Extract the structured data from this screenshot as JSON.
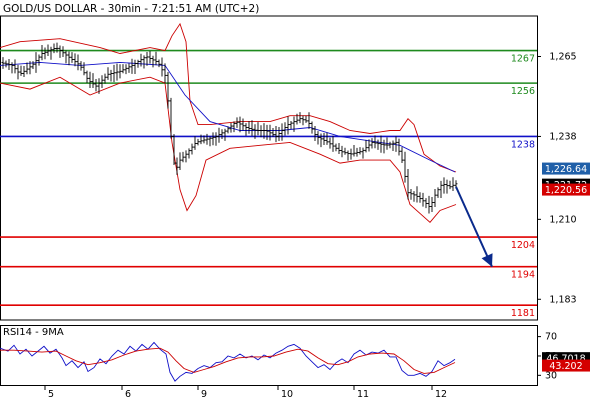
{
  "chart_data": [
    {
      "type": "candlestick",
      "title": "GOLD/US DOLLAR - 30min - 7:21:51 AM (UTC+2)",
      "ylim": [
        1176,
        1278
      ],
      "x_ticks": [
        "5",
        "6",
        "9",
        "10",
        "11",
        "12"
      ],
      "y_ticks": [
        {
          "value": 1265,
          "label": "1,265"
        },
        {
          "value": 1238,
          "label": "1,238"
        },
        {
          "value": 1210,
          "label": "1,210"
        },
        {
          "value": 1183,
          "label": "1,183"
        }
      ],
      "levels": [
        {
          "value": 1267,
          "label": "1267",
          "color": "#1e8a1e"
        },
        {
          "value": 1256,
          "label": "1256",
          "color": "#1e8a1e"
        },
        {
          "value": 1238,
          "label": "1238",
          "color": "#1010c8"
        },
        {
          "value": 1204,
          "label": "1204",
          "color": "#e00000"
        },
        {
          "value": 1194,
          "label": "1194",
          "color": "#e00000"
        },
        {
          "value": 1181,
          "label": "1181",
          "color": "#e00000"
        }
      ],
      "price_badges": [
        {
          "value": 1226.64,
          "label": "1,226.64",
          "color": "#1f5fa8"
        },
        {
          "value": 1221.72,
          "label": "1,221.72",
          "color": "#000000"
        },
        {
          "value": 1220.56,
          "label": "1,220.56",
          "color": "#d40000"
        }
      ],
      "close_path": [
        [
          0,
          1263
        ],
        [
          12,
          1262
        ],
        [
          20,
          1259
        ],
        [
          32,
          1262
        ],
        [
          42,
          1266
        ],
        [
          56,
          1268
        ],
        [
          68,
          1265
        ],
        [
          80,
          1262
        ],
        [
          88,
          1257
        ],
        [
          96,
          1255
        ],
        [
          108,
          1259
        ],
        [
          120,
          1260
        ],
        [
          132,
          1262
        ],
        [
          146,
          1265
        ],
        [
          158,
          1263
        ],
        [
          166,
          1258
        ],
        [
          171,
          1238
        ],
        [
          175,
          1226
        ],
        [
          180,
          1230
        ],
        [
          186,
          1232
        ],
        [
          196,
          1236
        ],
        [
          206,
          1237
        ],
        [
          216,
          1238
        ],
        [
          226,
          1240
        ],
        [
          236,
          1243
        ],
        [
          246,
          1241
        ],
        [
          256,
          1240
        ],
        [
          266,
          1240
        ],
        [
          276,
          1238
        ],
        [
          288,
          1242
        ],
        [
          300,
          1244
        ],
        [
          308,
          1243
        ],
        [
          316,
          1238
        ],
        [
          328,
          1236
        ],
        [
          340,
          1233
        ],
        [
          350,
          1232
        ],
        [
          362,
          1233
        ],
        [
          372,
          1236
        ],
        [
          386,
          1235
        ],
        [
          396,
          1236
        ],
        [
          402,
          1230
        ],
        [
          408,
          1219
        ],
        [
          416,
          1218
        ],
        [
          424,
          1216
        ],
        [
          430,
          1214
        ],
        [
          436,
          1219
        ],
        [
          442,
          1222
        ],
        [
          450,
          1221
        ],
        [
          456,
          1222
        ]
      ],
      "forecast_arrow": [
        [
          456,
          1221
        ],
        [
          492,
          1194
        ]
      ],
      "moving_average": [
        [
          0,
          1262
        ],
        [
          40,
          1263
        ],
        [
          80,
          1262
        ],
        [
          120,
          1263
        ],
        [
          165,
          1262
        ],
        [
          185,
          1252
        ],
        [
          210,
          1243
        ],
        [
          240,
          1240
        ],
        [
          280,
          1240
        ],
        [
          310,
          1241
        ],
        [
          340,
          1238
        ],
        [
          380,
          1236
        ],
        [
          400,
          1235
        ],
        [
          430,
          1230
        ],
        [
          455,
          1226
        ]
      ],
      "bollinger_upper": [
        [
          0,
          1268
        ],
        [
          20,
          1270
        ],
        [
          60,
          1271
        ],
        [
          100,
          1268
        ],
        [
          120,
          1266
        ],
        [
          150,
          1268
        ],
        [
          165,
          1267
        ],
        [
          172,
          1272
        ],
        [
          180,
          1276
        ],
        [
          186,
          1270
        ],
        [
          190,
          1250
        ],
        [
          198,
          1242
        ],
        [
          210,
          1242
        ],
        [
          240,
          1243
        ],
        [
          270,
          1243
        ],
        [
          290,
          1245
        ],
        [
          310,
          1245
        ],
        [
          330,
          1243
        ],
        [
          350,
          1240
        ],
        [
          370,
          1239
        ],
        [
          390,
          1240
        ],
        [
          400,
          1240
        ],
        [
          408,
          1244
        ],
        [
          414,
          1242
        ],
        [
          424,
          1232
        ],
        [
          440,
          1228
        ],
        [
          456,
          1226
        ]
      ],
      "bollinger_lower": [
        [
          0,
          1256
        ],
        [
          30,
          1254
        ],
        [
          60,
          1258
        ],
        [
          90,
          1252
        ],
        [
          120,
          1256
        ],
        [
          150,
          1258
        ],
        [
          165,
          1256
        ],
        [
          172,
          1236
        ],
        [
          180,
          1220
        ],
        [
          187,
          1213
        ],
        [
          196,
          1218
        ],
        [
          206,
          1230
        ],
        [
          230,
          1234
        ],
        [
          260,
          1235
        ],
        [
          290,
          1236
        ],
        [
          320,
          1232
        ],
        [
          340,
          1229
        ],
        [
          360,
          1230
        ],
        [
          390,
          1230
        ],
        [
          400,
          1226
        ],
        [
          410,
          1215
        ],
        [
          420,
          1212
        ],
        [
          430,
          1209
        ],
        [
          440,
          1213
        ],
        [
          456,
          1215
        ]
      ],
      "moving_average_color": "#1010c8",
      "bollinger_color": "#cc0000",
      "candle_color": "#000000"
    },
    {
      "type": "line",
      "title": "RSI14 - 9MA",
      "ylim": [
        20,
        82
      ],
      "y_ticks": [
        {
          "value": 70,
          "label": "70"
        },
        {
          "value": 50,
          "label": "50"
        },
        {
          "value": 30,
          "label": "30"
        }
      ],
      "badges": [
        {
          "value": 46.7018,
          "label": "46.7018",
          "color": "#000000"
        },
        {
          "value": 43.202,
          "label": "43.202",
          "color": "#d40000"
        }
      ],
      "series": [
        {
          "color": "#1010c8",
          "values": [
            [
              0,
              58
            ],
            [
              8,
              55
            ],
            [
              14,
              61
            ],
            [
              20,
              52
            ],
            [
              26,
              57
            ],
            [
              32,
              50
            ],
            [
              38,
              55
            ],
            [
              44,
              60
            ],
            [
              50,
              53
            ],
            [
              56,
              57
            ],
            [
              62,
              48
            ],
            [
              66,
              40
            ],
            [
              72,
              45
            ],
            [
              78,
              38
            ],
            [
              84,
              44
            ],
            [
              88,
              34
            ],
            [
              94,
              38
            ],
            [
              100,
              47
            ],
            [
              106,
              42
            ],
            [
              112,
              50
            ],
            [
              118,
              56
            ],
            [
              124,
              52
            ],
            [
              130,
              60
            ],
            [
              136,
              55
            ],
            [
              142,
              62
            ],
            [
              148,
              57
            ],
            [
              154,
              64
            ],
            [
              160,
              57
            ],
            [
              166,
              52
            ],
            [
              170,
              33
            ],
            [
              175,
              24
            ],
            [
              180,
              29
            ],
            [
              186,
              33
            ],
            [
              192,
              32
            ],
            [
              198,
              37
            ],
            [
              204,
              40
            ],
            [
              210,
              38
            ],
            [
              216,
              43
            ],
            [
              222,
              44
            ],
            [
              228,
              50
            ],
            [
              234,
              48
            ],
            [
              240,
              52
            ],
            [
              246,
              48
            ],
            [
              252,
              50
            ],
            [
              258,
              46
            ],
            [
              264,
              51
            ],
            [
              270,
              48
            ],
            [
              276,
              53
            ],
            [
              282,
              56
            ],
            [
              288,
              60
            ],
            [
              294,
              62
            ],
            [
              300,
              58
            ],
            [
              306,
              50
            ],
            [
              312,
              44
            ],
            [
              318,
              38
            ],
            [
              324,
              41
            ],
            [
              330,
              36
            ],
            [
              336,
              43
            ],
            [
              342,
              47
            ],
            [
              348,
              43
            ],
            [
              354,
              52
            ],
            [
              360,
              56
            ],
            [
              366,
              51
            ],
            [
              372,
              54
            ],
            [
              378,
              53
            ],
            [
              384,
              56
            ],
            [
              390,
              49
            ],
            [
              396,
              49
            ],
            [
              402,
              35
            ],
            [
              408,
              30
            ],
            [
              414,
              30
            ],
            [
              420,
              32
            ],
            [
              426,
              29
            ],
            [
              432,
              34
            ],
            [
              438,
              45
            ],
            [
              444,
              40
            ],
            [
              450,
              43
            ],
            [
              455,
              46.7
            ]
          ]
        },
        {
          "color": "#cc0000",
          "values": [
            [
              0,
              56
            ],
            [
              14,
              56
            ],
            [
              28,
              55
            ],
            [
              42,
              54
            ],
            [
              56,
              55
            ],
            [
              66,
              50
            ],
            [
              76,
              45
            ],
            [
              88,
              41
            ],
            [
              100,
              43
            ],
            [
              112,
              46
            ],
            [
              124,
              51
            ],
            [
              136,
              55
            ],
            [
              148,
              57
            ],
            [
              160,
              58
            ],
            [
              168,
              54
            ],
            [
              176,
              45
            ],
            [
              184,
              37
            ],
            [
              194,
              33
            ],
            [
              204,
              36
            ],
            [
              214,
              39
            ],
            [
              226,
              44
            ],
            [
              238,
              48
            ],
            [
              250,
              49
            ],
            [
              262,
              49
            ],
            [
              274,
              50
            ],
            [
              286,
              54
            ],
            [
              298,
              57
            ],
            [
              308,
              55
            ],
            [
              318,
              48
            ],
            [
              328,
              42
            ],
            [
              338,
              41
            ],
            [
              348,
              44
            ],
            [
              358,
              49
            ],
            [
              370,
              52
            ],
            [
              382,
              53
            ],
            [
              394,
              52
            ],
            [
              404,
              45
            ],
            [
              414,
              36
            ],
            [
              424,
              32
            ],
            [
              434,
              33
            ],
            [
              444,
              38
            ],
            [
              455,
              43.2
            ]
          ]
        }
      ]
    }
  ]
}
